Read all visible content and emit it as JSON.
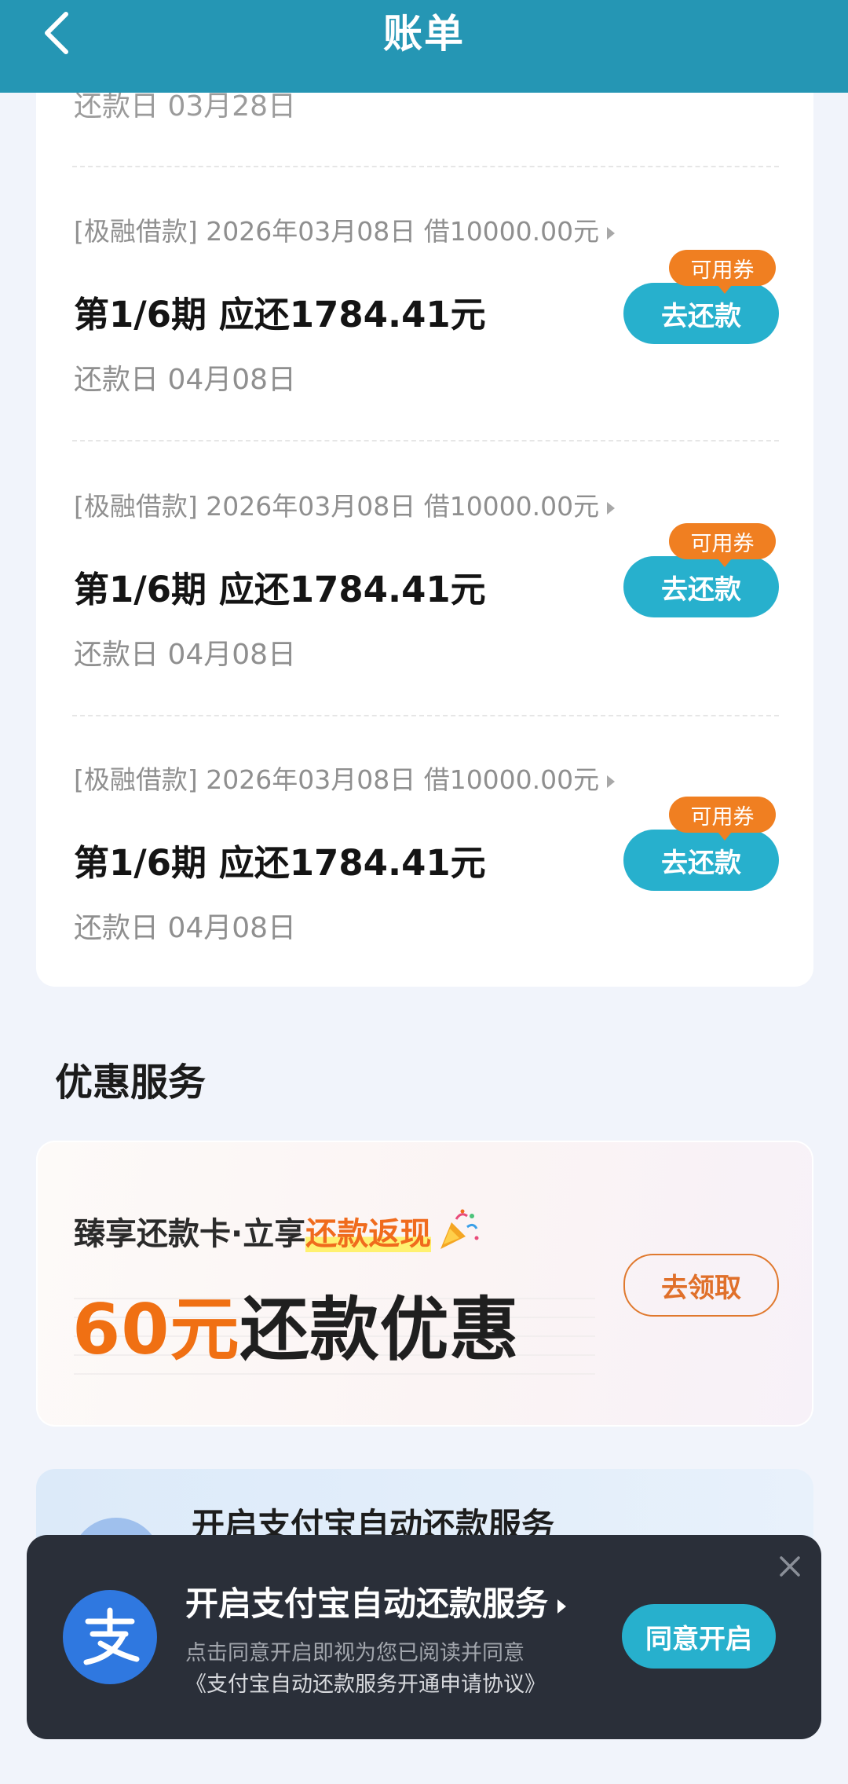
{
  "header": {
    "title": "账单"
  },
  "bills": {
    "partial_due_date": "还款日 03月28日",
    "items": [
      {
        "loan": "[极融借款] 2026年03月08日 借10000.00元",
        "period": "第1/6期 应还1784.41元",
        "due": "还款日 04月08日",
        "coupon": "可用券",
        "button": "去还款"
      },
      {
        "loan": "[极融借款] 2026年03月08日 借10000.00元",
        "period": "第1/6期 应还1784.41元",
        "due": "还款日 04月08日",
        "coupon": "可用券",
        "button": "去还款"
      },
      {
        "loan": "[极融借款] 2026年03月08日 借10000.00元",
        "period": "第1/6期 应还1784.41元",
        "due": "还款日 04月08日",
        "coupon": "可用券",
        "button": "去还款"
      }
    ]
  },
  "promo": {
    "section_title": "优惠服务",
    "sub_prefix": "臻享还款卡·立享",
    "sub_highlight": "还款返现",
    "amount": "60元",
    "big_suffix": "还款优惠",
    "button": "去领取"
  },
  "autopay_bg": {
    "title": "开启支付宝自动还款服务"
  },
  "popup": {
    "logo_char": "支",
    "title": "开启支付宝自动还款服务",
    "desc": "点击同意开启即视为您已阅读并同意",
    "agreement": "《支付宝自动还款服务开通申请协议》",
    "button": "同意开启"
  },
  "colors": {
    "header": "#2596b4",
    "primary_button": "#27b0cd",
    "coupon": "#f07f21",
    "promo_amount": "#f07013",
    "popup_bg": "#2a2f39"
  }
}
